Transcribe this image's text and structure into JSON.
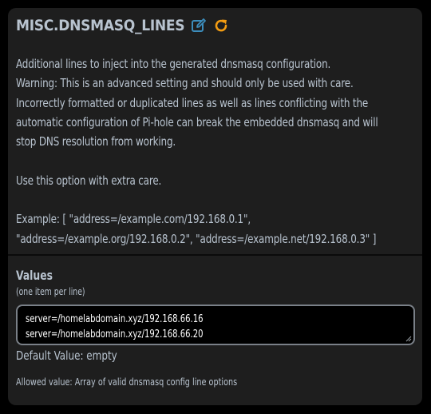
{
  "setting": {
    "title": "MISC.DNSMASQ_LINES",
    "icons": {
      "edit": "edit-icon",
      "reset": "refresh-icon",
      "edit_color": "#3c8dbc",
      "reset_color": "#f39c12"
    }
  },
  "description": {
    "lines": [
      "Additional lines to inject into the generated dnsmasq configuration.",
      "Warning: This is an advanced setting and should only be used with care.",
      "Incorrectly formatted or duplicated lines as well as lines conflicting with the",
      "automatic configuration of Pi-hole can break the embedded dnsmasq and will",
      "stop DNS resolution from working."
    ],
    "care_note": "Use this option with extra care.",
    "example_lines": [
      "Example: [ \"address=/example.com/192.168.0.1\",",
      "\"address=/example.org/192.168.0.2\", \"address=/example.net/192.168.0.3\" ]"
    ]
  },
  "values": {
    "label": "Values",
    "hint": "(one item per line)",
    "lines": [
      "server=/homelabdomain.xyz/192.168.66.16",
      "server=/homelabdomain.xyz/192.168.66.20"
    ],
    "default_value": "Default Value: empty",
    "allowed_value": "Allowed value: Array of valid dnsmasq config line options"
  }
}
